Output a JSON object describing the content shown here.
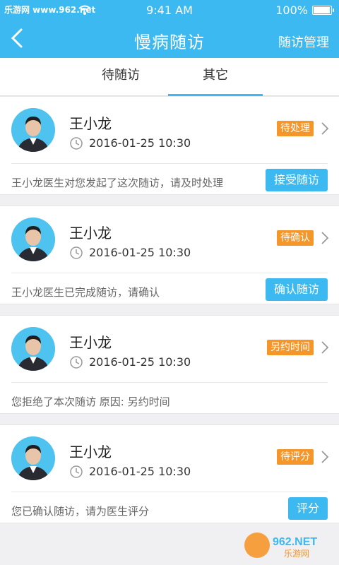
{
  "status_bar": {
    "watermark": "乐游网 www.962.net",
    "time": "9:41 AM",
    "battery": "100%",
    "battery_level": 1.0
  },
  "nav": {
    "title": "慢病随访",
    "right_action": "随访管理"
  },
  "tabs": [
    {
      "label": "待随访",
      "active": false
    },
    {
      "label": "其它",
      "active": true
    }
  ],
  "cards": [
    {
      "name": "王小龙",
      "datetime": "2016-01-25 10:30",
      "status": "待处理",
      "message": "王小龙医生对您发起了这次随访，请及时处理",
      "action": "接受随访"
    },
    {
      "name": "王小龙",
      "datetime": "2016-01-25 10:30",
      "status": "待确认",
      "message": "王小龙医生已完成随访，请确认",
      "action": "确认随访"
    },
    {
      "name": "王小龙",
      "datetime": "2016-01-25 10:30",
      "status": "另约时间",
      "message": "您拒绝了本次随访   原因: 另约时间",
      "action": ""
    },
    {
      "name": "王小龙",
      "datetime": "2016-01-25 10:30",
      "status": "待评分",
      "message": "您已确认随访，请为医生评分",
      "action": "评分"
    }
  ],
  "watermark_logo": "962.NET 乐游网",
  "colors": {
    "accent": "#3bb9f0",
    "badge": "#f5962a",
    "background": "#f0f0f2"
  }
}
